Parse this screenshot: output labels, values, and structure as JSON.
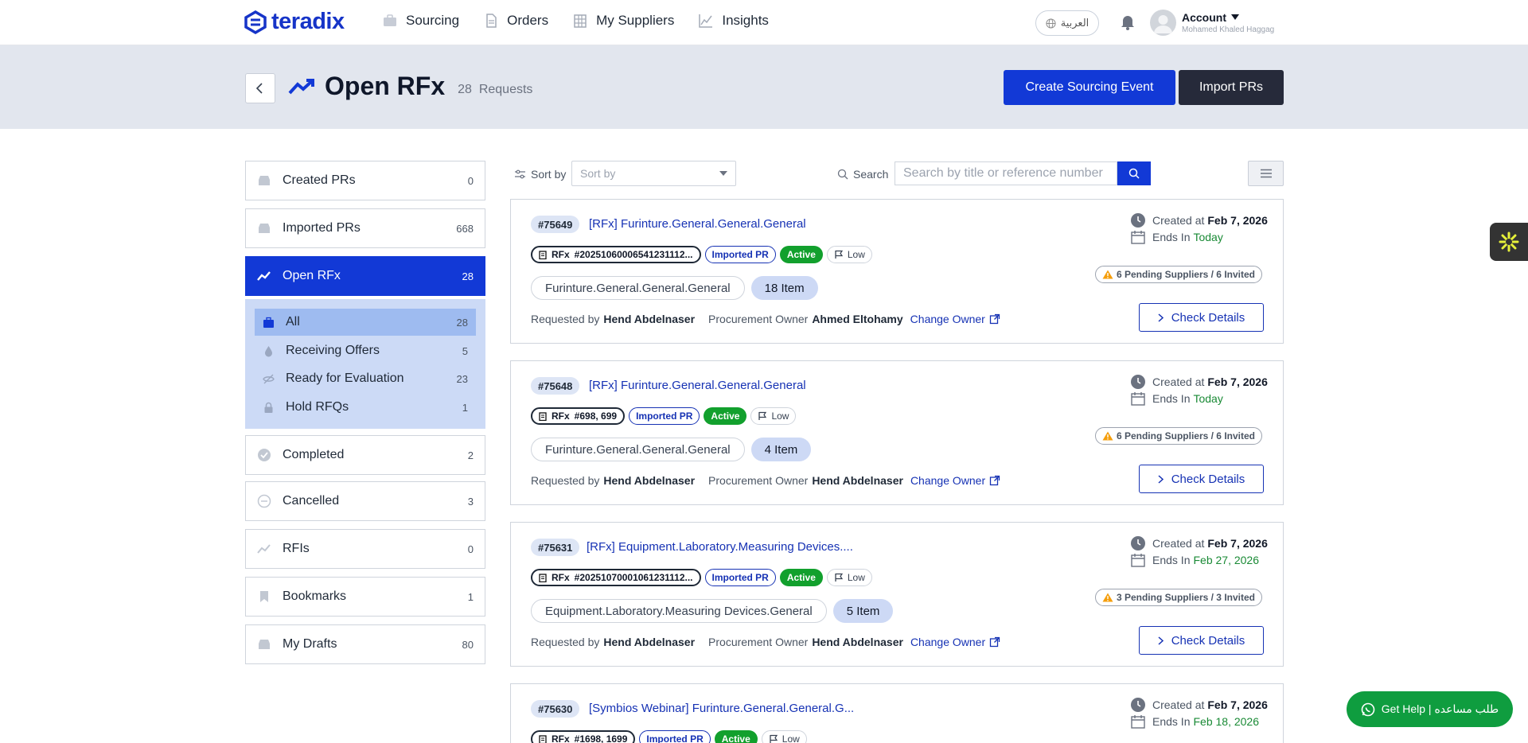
{
  "brand": {
    "name": "teradix",
    "color": "#1634c8"
  },
  "nav": {
    "items": [
      {
        "label": "Sourcing",
        "icon": "briefcase-icon"
      },
      {
        "label": "Orders",
        "icon": "document-icon"
      },
      {
        "label": "My Suppliers",
        "icon": "building-icon"
      },
      {
        "label": "Insights",
        "icon": "chart-icon"
      }
    ],
    "language": "العربية",
    "account_label": "Account",
    "account_user": "Mohamed Khaled Haggag"
  },
  "header": {
    "title": "Open RFx",
    "count": "28",
    "count_label": "Requests",
    "create_button": "Create Sourcing Event",
    "import_button": "Import PRs"
  },
  "sidebar": {
    "items": [
      {
        "label": "Created PRs",
        "count": "0",
        "icon": "inbox-icon"
      },
      {
        "label": "Imported PRs",
        "count": "668",
        "icon": "inbox-icon"
      },
      {
        "label": "Open RFx",
        "count": "28",
        "icon": "trend-icon"
      },
      {
        "label": "Completed",
        "count": "2",
        "icon": "check-circle-icon"
      },
      {
        "label": "Cancelled",
        "count": "3",
        "icon": "minus-circle-icon"
      },
      {
        "label": "RFIs",
        "count": "0",
        "icon": "trend-icon"
      },
      {
        "label": "Bookmarks",
        "count": "1",
        "icon": "bookmark-icon"
      },
      {
        "label": "My Drafts",
        "count": "80",
        "icon": "inbox-icon"
      }
    ],
    "sub_items": [
      {
        "label": "All",
        "count": "28",
        "icon": "briefcase-icon"
      },
      {
        "label": "Receiving Offers",
        "count": "5",
        "icon": "drop-icon"
      },
      {
        "label": "Ready for Evaluation",
        "count": "23",
        "icon": "eye-off-icon"
      },
      {
        "label": "Hold RFQs",
        "count": "1",
        "icon": "lock-icon"
      }
    ]
  },
  "toolbar": {
    "sort_label": "Sort by",
    "sort_value": "Sort by",
    "search_label": "Search",
    "search_placeholder": "Search by title or reference number"
  },
  "labels": {
    "created_at": "Created at",
    "ends_in": "Ends In",
    "requested_by": "Requested by",
    "procurement_owner": "Procurement Owner",
    "change_owner": "Change Owner",
    "check_details": "Check Details",
    "rfx": "RFx",
    "imported_pr": "Imported PR",
    "active": "Active",
    "low": "Low"
  },
  "cards": [
    {
      "id": "#75649",
      "title": "[RFx] Furinture.General.General.General",
      "ref": "#20251060006541231112...",
      "category": "Furinture.General.General.General",
      "items": "18 Item",
      "requested_by": "Hend Abdelnaser",
      "owner": "Ahmed Eltohamy",
      "created": "Feb 7, 2026",
      "ends": "Today",
      "pending": "6 Pending Suppliers / 6 Invited"
    },
    {
      "id": "#75648",
      "title": "[RFx] Furinture.General.General.General",
      "ref": "#698, 699",
      "category": "Furinture.General.General.General",
      "items": "4 Item",
      "requested_by": "Hend Abdelnaser",
      "owner": "Hend Abdelnaser",
      "created": "Feb 7, 2026",
      "ends": "Today",
      "pending": "6 Pending Suppliers / 6 Invited"
    },
    {
      "id": "#75631",
      "title": "[RFx] Equipment.Laboratory.Measuring Devices....",
      "ref": "#20251070001061231112...",
      "category": "Equipment.Laboratory.Measuring Devices.General",
      "items": "5 Item",
      "requested_by": "Hend Abdelnaser",
      "owner": "Hend Abdelnaser",
      "created": "Feb 7, 2026",
      "ends": "Feb 27, 2026",
      "pending": "3 Pending Suppliers / 3 Invited"
    },
    {
      "id": "#75630",
      "title": "[Symbios Webinar] Furinture.General.General.G...",
      "ref": "#1698, 1699",
      "created": "Feb 7, 2026",
      "ends": "Feb 18, 2026"
    }
  ],
  "help": {
    "label": "Get Help | طلب مساعده"
  }
}
